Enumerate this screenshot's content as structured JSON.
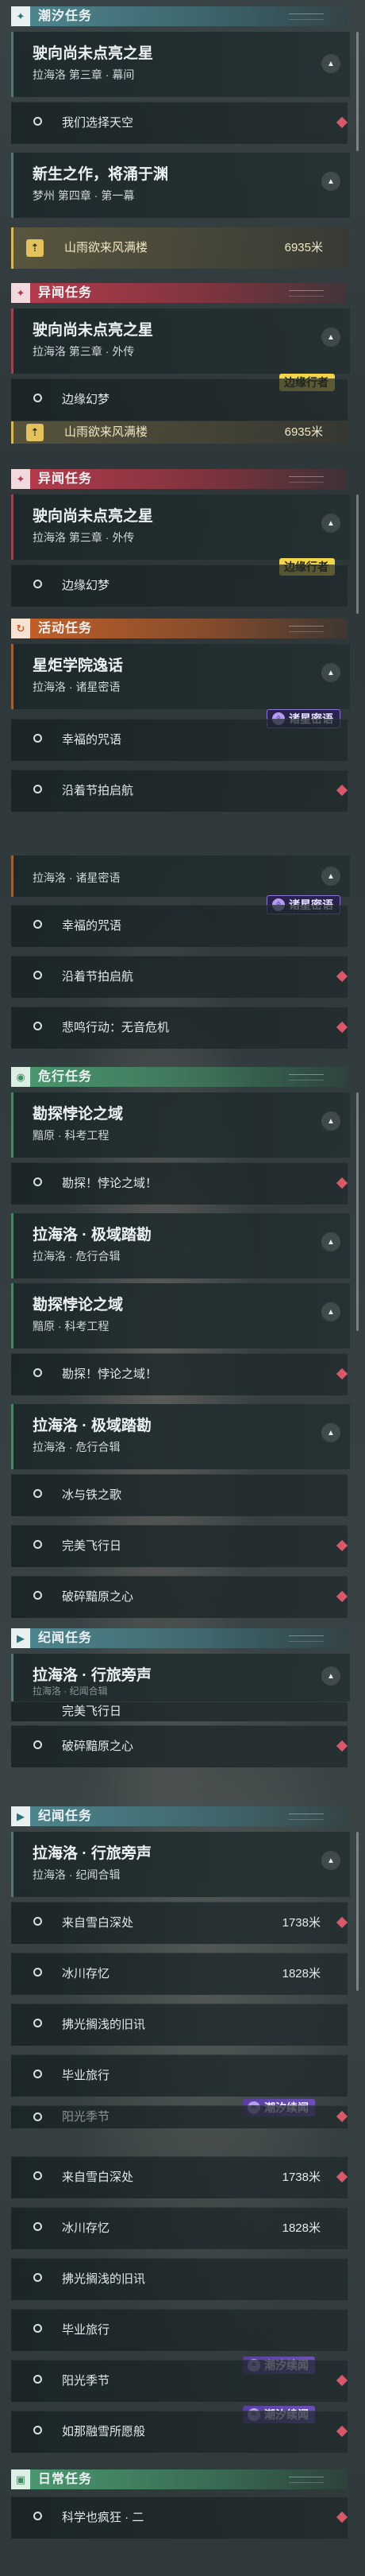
{
  "sections": {
    "tidal": "潮汐任务",
    "anomaly": "异闻任务",
    "event": "活动任务",
    "danger": "危行任务",
    "chronicle": "纪闻任务",
    "daily": "日常任务"
  },
  "quests": {
    "q1": {
      "name": "驶向尚未点亮之星",
      "sub": "拉海洛 第三章 · 幕间"
    },
    "q2": {
      "name": "新生之作，将涌于渊",
      "sub": "梦州 第四章 · 第一幕"
    },
    "q3": {
      "name": "驶向尚未点亮之星",
      "sub": "拉海洛 第三章 · 外传"
    },
    "q4": {
      "name": "驶向尚未点亮之星",
      "sub": "拉海洛 第三章 · 外传"
    },
    "q5": {
      "name": "星炬学院逸话",
      "sub": "拉海洛 · 诸星密语"
    },
    "q5b": {
      "sub": "拉海洛 · 诸星密语"
    },
    "q6": {
      "name": "勘探悖论之域",
      "sub": "黯原 · 科考工程"
    },
    "q7": {
      "name": "拉海洛 · 极域踏勘",
      "sub": "拉海洛 · 危行合辑"
    },
    "q8": {
      "name": "勘探悖论之域",
      "sub": "黯原 · 科考工程"
    },
    "q9": {
      "name": "拉海洛 · 极域踏勘",
      "sub": "拉海洛 · 危行合辑"
    },
    "q10": {
      "name": "拉海洛 · 行旅旁声",
      "sub": "拉海洛 · 纪闻合辑"
    },
    "q11": {
      "name": "拉海洛 · 行旅旁声",
      "sub": "拉海洛 · 纪闻合辑"
    }
  },
  "rows": {
    "r1": "我们选择天空",
    "r2": "山雨欲来风满楼",
    "r2d": "6935米",
    "r2b": "山雨欲来风满楼",
    "r2bd": "6935米",
    "r3": "边缘幻梦",
    "r4": "边缘幻梦",
    "r5": "幸福的咒语",
    "r6": "沿着节拍启航",
    "r7": "幸福的咒语",
    "r8": "沿着节拍启航",
    "r9": "悲鸣行动：无音危机",
    "r10": "勘探！悖论之域！",
    "r11": "勘探！悖论之域！",
    "r12": "冰与铁之歌",
    "r13": "完美飞行日",
    "r14": "破碎黯原之心",
    "r15": "完美飞行日",
    "r16": "破碎黯原之心",
    "r17": "来自雪白深处",
    "r17d": "1738米",
    "r18": "冰川存忆",
    "r18d": "1828米",
    "r19": "拂光搁浅的旧讯",
    "r20": "毕业旅行",
    "r21": "阳光季节",
    "r22": "来自雪白深处",
    "r22d": "1738米",
    "r23": "冰川存忆",
    "r23d": "1828米",
    "r24": "拂光搁浅的旧讯",
    "r25": "毕业旅行",
    "r26": "阳光季节",
    "r27": "如那融雪所愿般",
    "r28": "科学也疯狂 · 二"
  },
  "tags": {
    "edge_walker": "边缘行者",
    "stars_whisper": "诸星密语",
    "tidal_sequel": "潮汐续闻"
  },
  "icons": {
    "tidal": "plus-star-icon",
    "anomaly": "plus-star-icon",
    "event": "refresh-icon",
    "danger": "eye-icon",
    "chronicle": "play-icon",
    "daily": "box-icon"
  },
  "colors": {
    "accent_red": "#d85a6a",
    "tag_yellow": "#f2d54a",
    "tag_purple": "#6c4fb8"
  }
}
